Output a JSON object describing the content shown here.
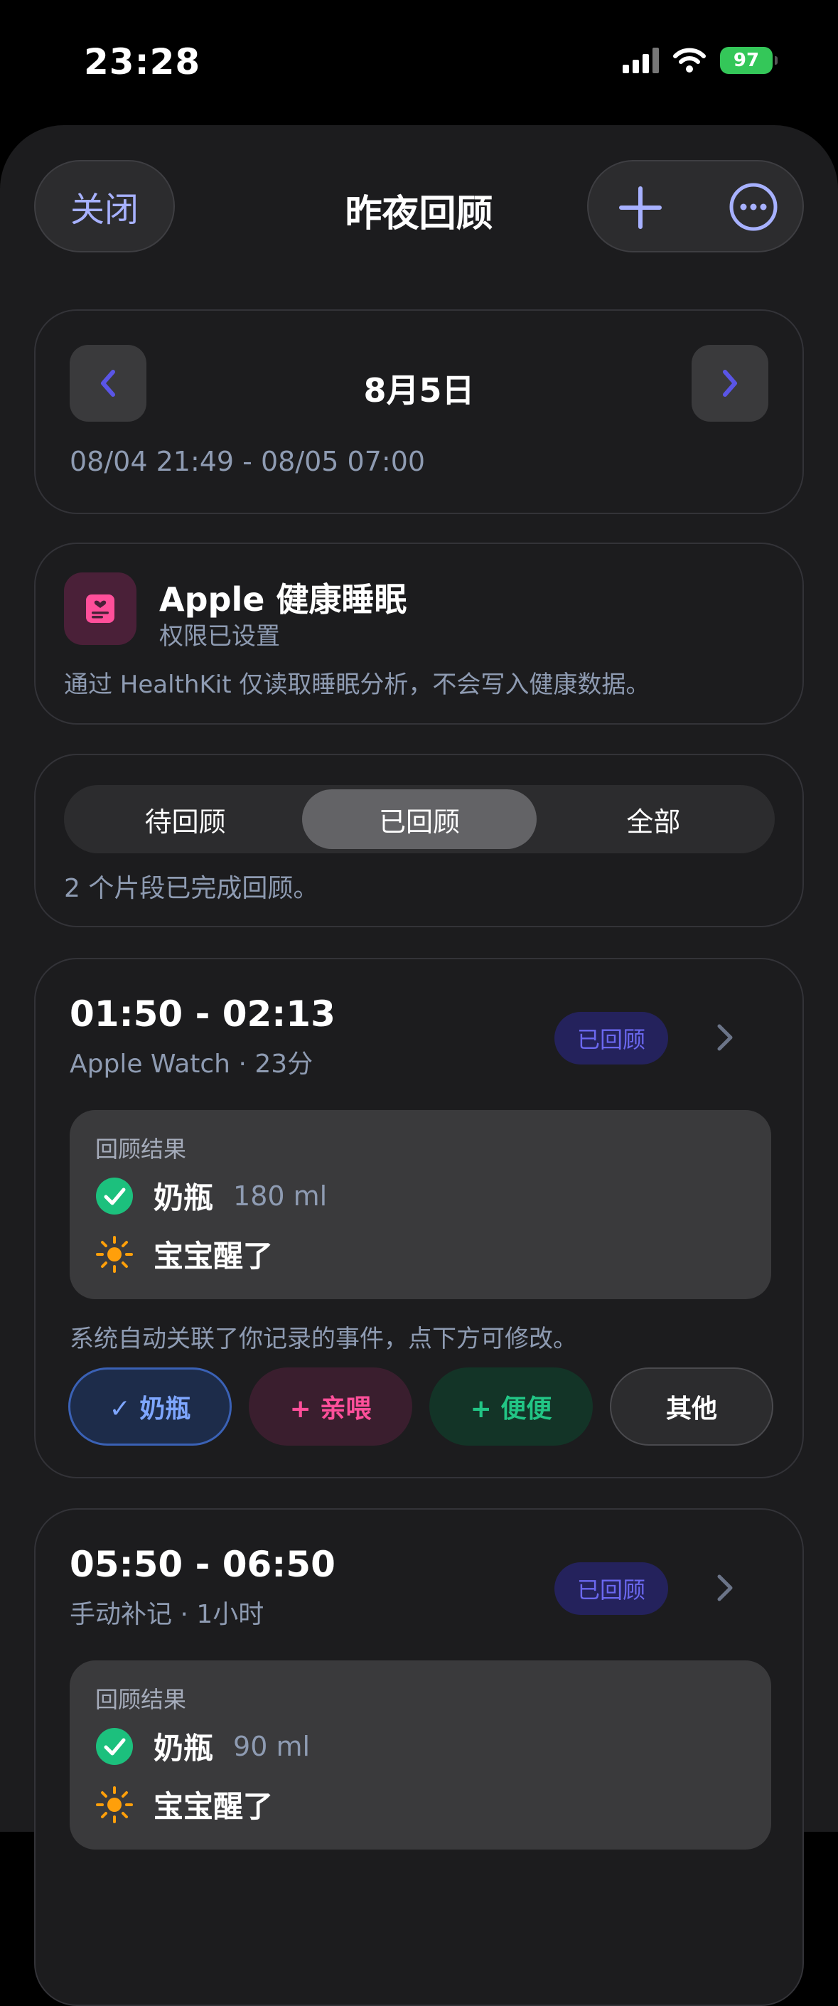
{
  "status_bar": {
    "time": "23:28",
    "battery": "97"
  },
  "nav": {
    "close_label": "关闭",
    "title": "昨夜回顾"
  },
  "date_nav": {
    "title": "8月5日",
    "range": "08/04 21:49 - 08/05 07:00"
  },
  "health": {
    "title": "Apple 健康睡眠",
    "status": "权限已设置",
    "note": "通过 HealthKit 仅读取睡眠分析，不会写入健康数据。"
  },
  "filter": {
    "segments": [
      "待回顾",
      "已回顾",
      "全部"
    ],
    "selected": "已回顾",
    "summary": "2 个片段已完成回顾。"
  },
  "sessions": [
    {
      "time": "01:50 - 02:13",
      "meta": "Apple Watch · 23分",
      "badge": "已回顾",
      "result_label": "回顾结果",
      "results": [
        {
          "icon": "check-circle-icon",
          "name": "奶瓶",
          "amount": "180 ml"
        },
        {
          "icon": "sun-icon",
          "name": "宝宝醒了",
          "amount": ""
        }
      ],
      "note": "系统自动关联了你记录的事件，点下方可修改。",
      "chips": [
        "✓ 奶瓶",
        "+ 亲喂",
        "+ 便便",
        "其他"
      ]
    },
    {
      "time": "05:50 - 06:50",
      "meta": "手动补记 · 1小时",
      "badge": "已回顾",
      "result_label": "回顾结果",
      "results": [
        {
          "icon": "check-circle-icon",
          "name": "奶瓶",
          "amount": "90 ml"
        },
        {
          "icon": "sun-icon",
          "name": "宝宝醒了",
          "amount": ""
        }
      ]
    }
  ],
  "colors": {
    "accent": "#6b68f0",
    "sheet_bg": "#1c1c1e",
    "success": "#1cc07d",
    "sun": "#ff9f0a",
    "health_pink": "#ff4f9a"
  }
}
